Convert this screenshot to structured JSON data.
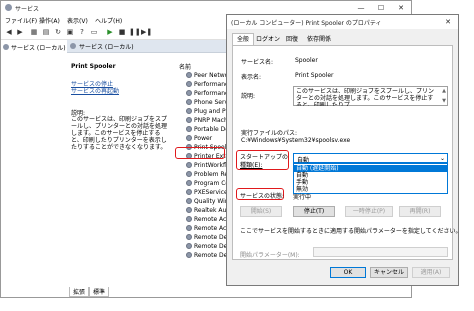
{
  "services_window": {
    "title": "サービス",
    "menu": [
      "ファイル(F)",
      "操作(A)",
      "表示(V)",
      "ヘルプ(H)"
    ],
    "tree_item": "サービス (ローカル)",
    "pane_header": "サービス (ローカル)",
    "selected_service": "Print Spooler",
    "actions": [
      "サービスの停止",
      "サービスの再起動"
    ],
    "description_label": "説明:",
    "description": "このサービスは、印刷ジョブをスプールし、プリンターとの対話を処理します。このサービスを停止すると、印刷したりプリンターを表示したりすることができなくなります。",
    "column_name": "名前",
    "services": [
      "Peer Networki",
      "Performance C",
      "Performance L",
      "Phone Service",
      "Plug and Play",
      "PNRP Machine",
      "Portable Devic",
      "Power",
      "Print Spooler",
      "Printer Extensi",
      "PrintWorkflow",
      "Problem Repo",
      "Program Com",
      "PXEService",
      "Quality Windo",
      "Realtek Audio",
      "Remote Access",
      "Remote Access",
      "Remote Deskt",
      "Remote Deskt",
      "Remote Deskt"
    ],
    "bottom_tabs": [
      "拡張",
      "標準"
    ]
  },
  "dialog": {
    "title": "(ローカル コンピューター) Print Spooler のプロパティ",
    "tabs": [
      "全般",
      "ログオン",
      "回復",
      "依存関係"
    ],
    "service_name_label": "サービス名:",
    "service_name": "Spooler",
    "display_name_label": "表示名:",
    "display_name": "Print Spooler",
    "description_label": "説明:",
    "description": "このサービスは、印刷ジョブをスプールし、プリンターとの対話を処理します。このサービスを停止すると、印刷したりプ",
    "path_label": "実行ファイルのパス:",
    "path": "C:¥Windows¥System32¥spoolsv.exe",
    "startup_label_1": "スタートアップの",
    "startup_label_2": "種類(E):",
    "startup_value": "自動",
    "startup_options": [
      "自動 (遅延開始)",
      "自動",
      "手動",
      "無効"
    ],
    "status_label": "サービスの状態:",
    "status_value": "実行中",
    "buttons": [
      "開始(S)",
      "停止(T)",
      "一時停止(P)",
      "再開(R)"
    ],
    "hint": "ここでサービスを開始するときに適用する開始パラメーターを指定してください。",
    "param_label": "開始パラメーター(M):",
    "ok": "OK",
    "cancel": "キャンセル",
    "apply": "適用(A)"
  }
}
